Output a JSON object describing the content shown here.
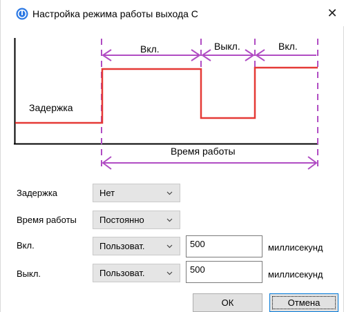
{
  "window": {
    "title": "Настройка режима работы выхода C",
    "close_glyph": "✕",
    "app_icon": "power-info-icon",
    "accent": "#2b78e4"
  },
  "diagram": {
    "label_on_1": "Вкл.",
    "label_off": "Выкл.",
    "label_on_2": "Вкл.",
    "label_delay": "Задержка",
    "label_work_time": "Время работы",
    "signal_color": "#e53935",
    "marker_color": "#b04cc3"
  },
  "form": {
    "delay": {
      "label": "Задержка",
      "value": "Нет"
    },
    "work_time": {
      "label": "Время работы",
      "value": "Постоянно"
    },
    "on": {
      "label": "Вкл.",
      "value": "Пользоват.",
      "input_value": "500",
      "unit": "миллисекунд"
    },
    "off": {
      "label": "Выкл.",
      "value": "Пользоват.",
      "input_value": "500",
      "unit": "миллисекунд"
    },
    "chevron_icon": "chevron-down-icon"
  },
  "buttons": {
    "ok": "ОК",
    "cancel": "Отмена"
  }
}
